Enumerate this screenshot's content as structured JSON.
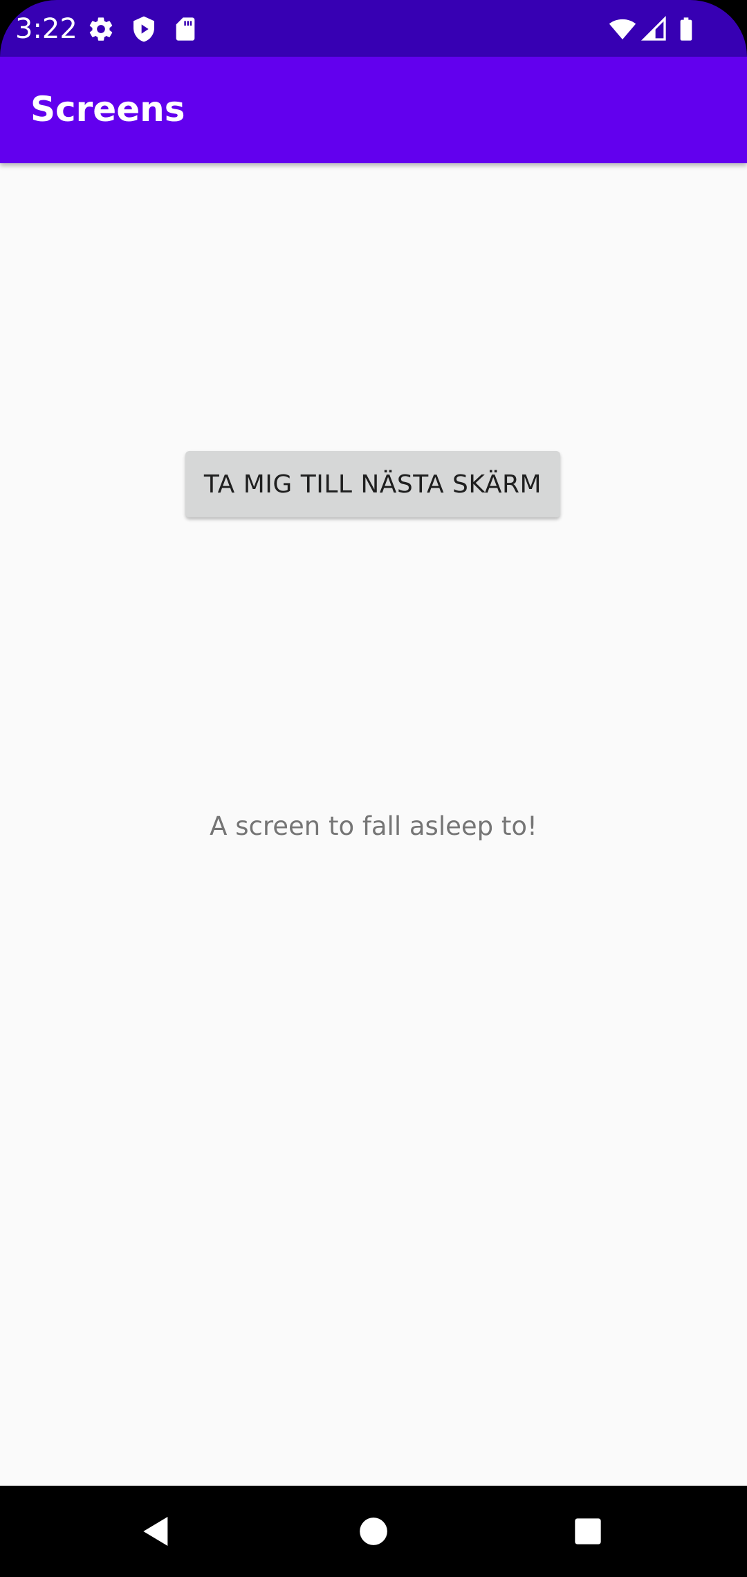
{
  "status_bar": {
    "time": "3:22",
    "left_icons": [
      "gear-icon",
      "shield-play-icon",
      "sd-card-icon"
    ],
    "right_icons": [
      "wifi-icon",
      "cell-signal-icon",
      "battery-icon"
    ],
    "background": "#3700b3"
  },
  "app_bar": {
    "title": "Screens",
    "background": "#6200ee"
  },
  "main": {
    "button_label": "TA MIG TILL NÄSTA SKÄRM",
    "caption": "A screen to fall asleep to!",
    "background": "#fafafa"
  },
  "nav_bar": {
    "buttons": [
      "back-icon",
      "home-icon",
      "recents-icon"
    ]
  }
}
